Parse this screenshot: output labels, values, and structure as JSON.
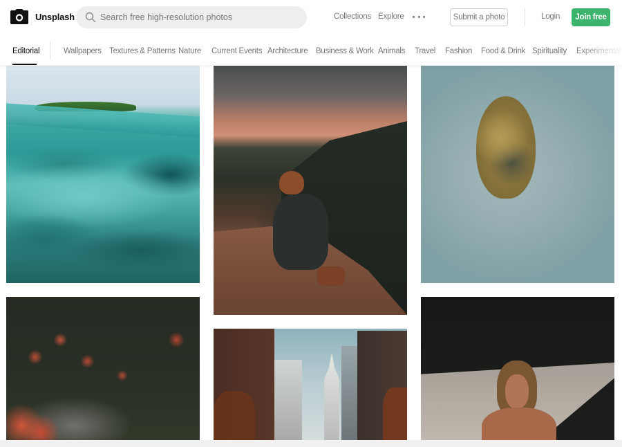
{
  "brand": {
    "name": "Unsplash",
    "logo_icon": "camera-icon"
  },
  "search": {
    "placeholder": "Search free high-resolution photos",
    "value": "",
    "icon": "search-icon"
  },
  "header_nav": {
    "links": [
      {
        "label": "Collections"
      },
      {
        "label": "Explore"
      }
    ],
    "more_icon": "ellipsis-icon",
    "submit_label": "Submit a photo",
    "login_label": "Login",
    "join_label": "Join free"
  },
  "topics": {
    "active": "Editorial",
    "items": [
      {
        "label": "Editorial"
      },
      {
        "label": "Wallpapers"
      },
      {
        "label": "Textures & Patterns"
      },
      {
        "label": "Nature"
      },
      {
        "label": "Current Events"
      },
      {
        "label": "Architecture"
      },
      {
        "label": "Business & Work"
      },
      {
        "label": "Animals"
      },
      {
        "label": "Travel"
      },
      {
        "label": "Fashion"
      },
      {
        "label": "Food & Drink"
      },
      {
        "label": "Spirituality"
      },
      {
        "label": "Experimental"
      }
    ]
  },
  "photos": [
    {
      "subject": "Underwater coral reef with tropical island above waterline"
    },
    {
      "subject": "Person in orange beanie sitting on rock at sunset overlooking hills"
    },
    {
      "subject": "Aerial view of small tree-covered island in pale blue lake"
    },
    {
      "subject": "Red berries and flowers on dark green background"
    },
    {
      "subject": "New York City street with Chrysler Building"
    },
    {
      "subject": "Shirtless man with long hair in sunlight and shadow"
    }
  ],
  "colors": {
    "accent_green": "#3cb46e",
    "text_primary": "#111111",
    "text_muted": "#767676",
    "search_bg": "#eeeeee"
  }
}
